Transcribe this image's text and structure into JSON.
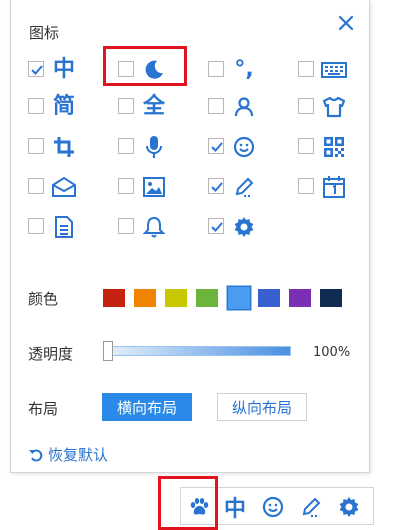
{
  "panel": {
    "title": "图标",
    "close_icon": "close-icon"
  },
  "icons": [
    {
      "name": "chinese-mode",
      "glyph": "中",
      "checked": true
    },
    {
      "name": "moon",
      "glyph": "",
      "checked": false
    },
    {
      "name": "punctuation",
      "glyph": "°,",
      "checked": false
    },
    {
      "name": "keyboard",
      "glyph": "",
      "checked": false
    },
    {
      "name": "simplified",
      "glyph": "简",
      "checked": false
    },
    {
      "name": "full-width",
      "glyph": "全",
      "checked": false
    },
    {
      "name": "user",
      "glyph": "",
      "checked": false
    },
    {
      "name": "skin",
      "glyph": "",
      "checked": false
    },
    {
      "name": "crop",
      "glyph": "",
      "checked": false
    },
    {
      "name": "microphone",
      "glyph": "",
      "checked": false
    },
    {
      "name": "emoji",
      "glyph": "",
      "checked": true
    },
    {
      "name": "qrcode",
      "glyph": "",
      "checked": false
    },
    {
      "name": "mail",
      "glyph": "",
      "checked": false
    },
    {
      "name": "image",
      "glyph": "",
      "checked": false
    },
    {
      "name": "pencil",
      "glyph": "",
      "checked": true
    },
    {
      "name": "calendar",
      "glyph": "",
      "checked": false
    },
    {
      "name": "document",
      "glyph": "",
      "checked": false
    },
    {
      "name": "bell",
      "glyph": "",
      "checked": false
    },
    {
      "name": "gear",
      "glyph": "",
      "checked": true
    }
  ],
  "color": {
    "label": "颜色",
    "swatches": [
      "#c4230f",
      "#f08300",
      "#c8c800",
      "#6cb43c",
      "#4a9cf0",
      "#3a5fcf",
      "#7a2fb4",
      "#0f2d52"
    ],
    "selected_index": 4
  },
  "opacity": {
    "label": "透明度",
    "value": "100%"
  },
  "layout": {
    "label": "布局",
    "options": [
      "横向布局",
      "纵向布局"
    ],
    "selected": "横向布局"
  },
  "reset_label": "恢复默认",
  "toolbar": {
    "items": [
      "paw-icon",
      "中",
      "emoji-icon",
      "pencil-icon",
      "gear-icon"
    ],
    "chinese_label": "中"
  }
}
